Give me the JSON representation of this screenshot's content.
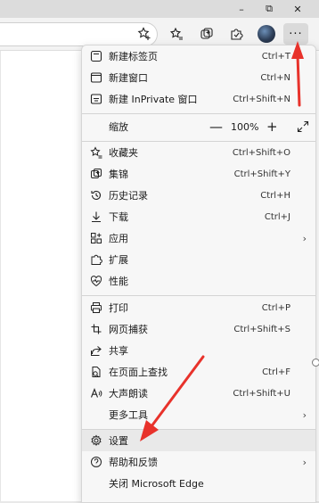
{
  "window": {
    "minimize": "–",
    "maximize": "⧉",
    "close": "✕"
  },
  "toolbar": {
    "more_glyph": "···"
  },
  "menu": {
    "new_tab": {
      "label": "新建标签页",
      "shortcut": "Ctrl+T"
    },
    "new_window": {
      "label": "新建窗口",
      "shortcut": "Ctrl+N"
    },
    "new_inprivate": {
      "label": "新建 InPrivate 窗口",
      "shortcut": "Ctrl+Shift+N"
    },
    "zoom": {
      "label": "缩放",
      "minus": "—",
      "value": "100%",
      "plus": "+"
    },
    "favorites": {
      "label": "收藏夹",
      "shortcut": "Ctrl+Shift+O"
    },
    "collections": {
      "label": "集锦",
      "shortcut": "Ctrl+Shift+Y"
    },
    "history": {
      "label": "历史记录",
      "shortcut": "Ctrl+H"
    },
    "downloads": {
      "label": "下载",
      "shortcut": "Ctrl+J"
    },
    "apps": {
      "label": "应用"
    },
    "extensions": {
      "label": "扩展"
    },
    "performance": {
      "label": "性能"
    },
    "print": {
      "label": "打印",
      "shortcut": "Ctrl+P"
    },
    "web_capture": {
      "label": "网页捕获",
      "shortcut": "Ctrl+Shift+S"
    },
    "share": {
      "label": "共享"
    },
    "find": {
      "label": "在页面上查找",
      "shortcut": "Ctrl+F"
    },
    "read_aloud": {
      "label": "大声朗读",
      "shortcut": "Ctrl+Shift+U"
    },
    "more_tools": {
      "label": "更多工具"
    },
    "settings": {
      "label": "设置"
    },
    "help_feedback": {
      "label": "帮助和反馈"
    },
    "close_edge": {
      "label": "关闭 Microsoft Edge"
    }
  },
  "colors": {
    "annotation_arrow": "#e8322b",
    "menu_bg": "#f7f7f7",
    "hover_bg": "#e9e9e9"
  },
  "icons": [
    "star-plus-icon",
    "favorites-icon",
    "collections-icon",
    "extensions-icon",
    "more-icon"
  ]
}
